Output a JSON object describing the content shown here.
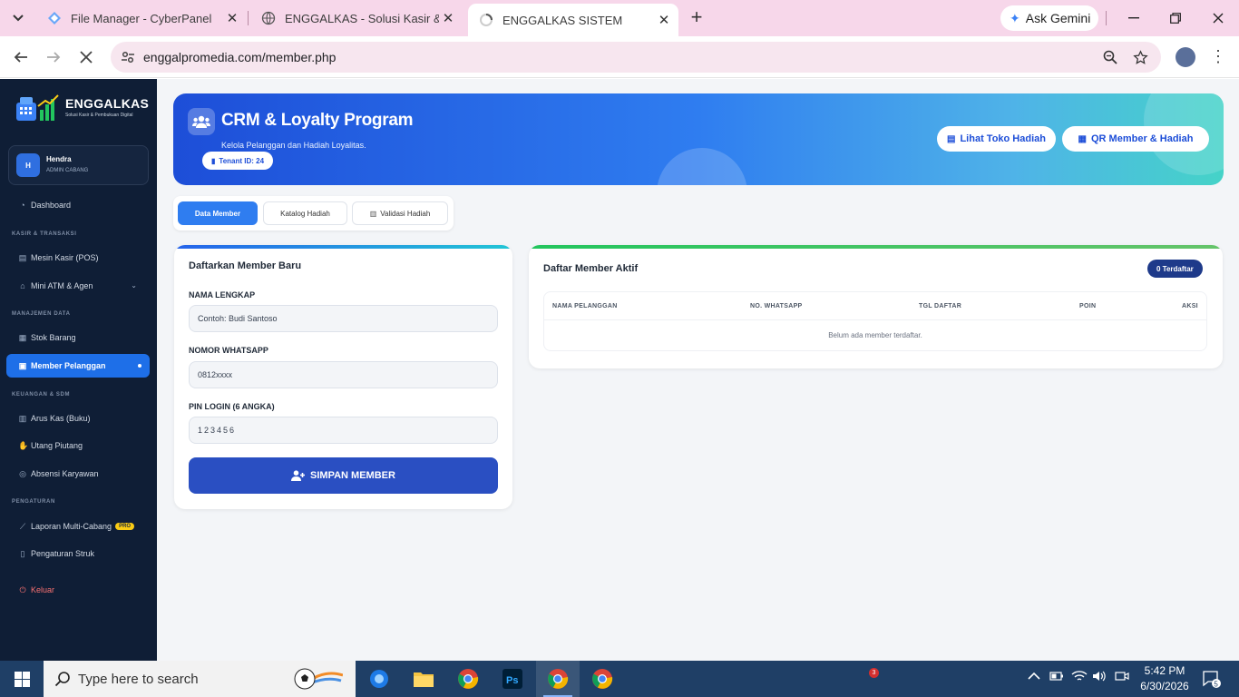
{
  "browser": {
    "tabs": [
      {
        "title": "File Manager - CyberPanel"
      },
      {
        "title": "ENGGALKAS - Solusi Kasir & Pe"
      },
      {
        "title": "ENGGALKAS SISTEM"
      }
    ],
    "gemini_label": "Ask Gemini",
    "url": "enggalpromedia.com/member.php"
  },
  "sidebar": {
    "brand": "ENGGALKAS",
    "tagline": "Solusi Kasir & Pembukuan Digital",
    "user": {
      "initial": "H",
      "name": "Hendra",
      "role": "ADMIN CABANG"
    },
    "sections": {
      "kasir": "KASIR & TRANSAKSI",
      "data": "MANAJEMEN DATA",
      "keuangan": "KEUANGAN & SDM",
      "pengaturan": "PENGATURAN"
    },
    "items": {
      "dashboard": "Dashboard",
      "pos": "Mesin Kasir (POS)",
      "atm": "Mini ATM & Agen",
      "stok": "Stok Barang",
      "member": "Member Pelanggan",
      "kas": "Arus Kas (Buku)",
      "utang": "Utang Piutang",
      "absensi": "Absensi Karyawan",
      "laporan": "Laporan Multi-Cabang",
      "struk": "Pengaturan Struk",
      "keluar": "Keluar"
    },
    "pro_badge": "PRO"
  },
  "hero": {
    "title": "CRM & Loyalty Program",
    "subtitle": "Kelola Pelanggan dan Hadiah Loyalitas.",
    "tenant": "Tenant ID: 24",
    "btn_toko": "Lihat Toko Hadiah",
    "btn_qr": "QR Member & Hadiah"
  },
  "tabs": {
    "data_member": "Data Member",
    "katalog": "Katalog Hadiah",
    "validasi": "Validasi Hadiah"
  },
  "form": {
    "title": "Daftarkan Member Baru",
    "nama_label": "NAMA LENGKAP",
    "nama_placeholder": "Contoh: Budi Santoso",
    "wa_label": "NOMOR WHATSAPP",
    "wa_placeholder": "0812xxxx",
    "pin_label": "PIN LOGIN (6 ANGKA)",
    "pin_placeholder": "123456",
    "save": "SIMPAN MEMBER"
  },
  "members": {
    "title": "Daftar Member Aktif",
    "count_badge": "0 Terdaftar",
    "columns": [
      "NAMA PELANGGAN",
      "NO. WHATSAPP",
      "TGL DAFTAR",
      "POIN",
      "AKSI"
    ],
    "empty": "Belum ada member terdaftar."
  },
  "taskbar": {
    "search_placeholder": "Type here to search",
    "notif_count": "3",
    "time": "5:42 PM",
    "date": "6/30/2026",
    "action_center_count": "5"
  },
  "colors": {
    "sidebar_bg": "#0f1e36",
    "accent": "#1e6fe8",
    "save_button": "#2a4fc2",
    "badge": "#1e3a8a"
  }
}
